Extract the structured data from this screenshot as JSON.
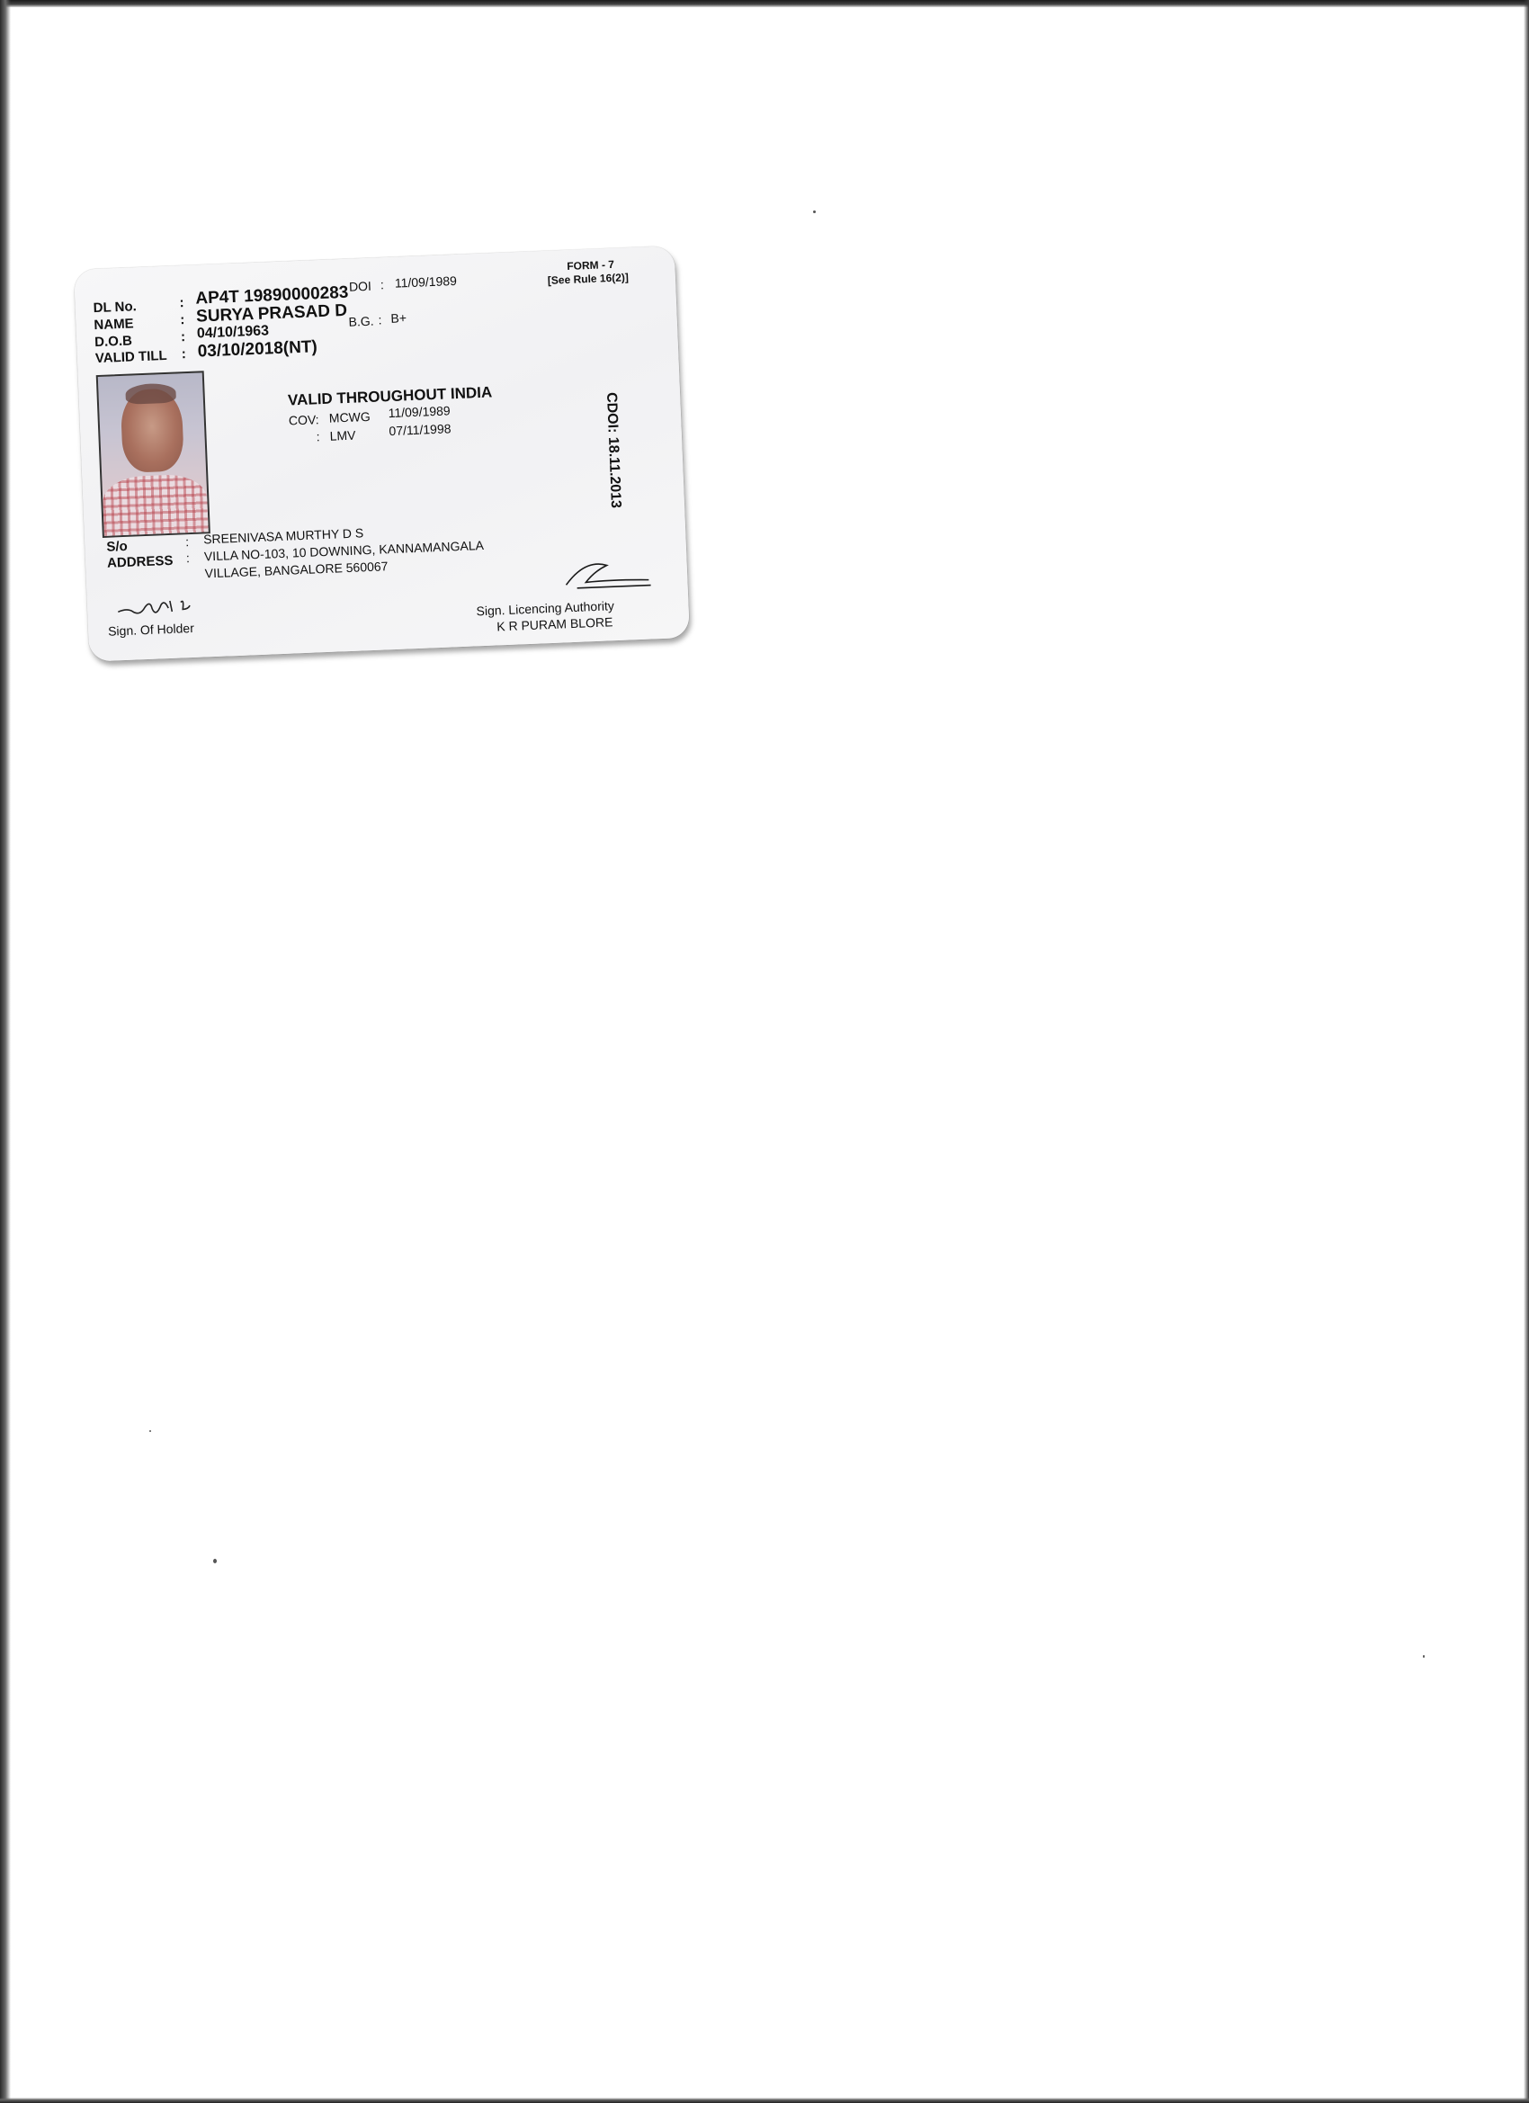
{
  "license": {
    "dl_no_label": "DL No.",
    "dl_no_value": "AP4T 19890000283",
    "name_label": "NAME",
    "name_value": "SURYA PRASAD D",
    "dob_label": "D.O.B",
    "dob_value": "04/10/1963",
    "valid_till_label": "VALID TILL",
    "valid_till_value": "03/10/2018(NT)",
    "colon": ":",
    "doi_label": "DOI",
    "doi_value": "11/09/1989",
    "bg_label": "B.G.",
    "bg_value": "B+",
    "form_title": "FORM - 7",
    "form_rule": "[See Rule  16(2)]",
    "valid_throughout": "VALID THROUGHOUT INDIA",
    "cov_label": "COV:",
    "cov": [
      {
        "class": "MCWG",
        "date": "11/09/1989"
      },
      {
        "class": "LMV",
        "date": "07/11/1998"
      }
    ],
    "cdoi": "CDOI: 18.11.2013",
    "so_label": "S/o",
    "so_value": "SREENIVASA MURTHY D S",
    "address_label": "ADDRESS",
    "address_line1": "VILLA NO-103, 10 DOWNING, KANNAMANGALA",
    "address_line2": "VILLAGE,  BANGALORE 560067",
    "holder_sign_label": "Sign. Of Holder",
    "authority_sign_label": "Sign. Licencing Authority",
    "authority_office": "K R PURAM BLORE"
  },
  "colors": {
    "card": "#f3f3f5",
    "text": "#111111"
  }
}
